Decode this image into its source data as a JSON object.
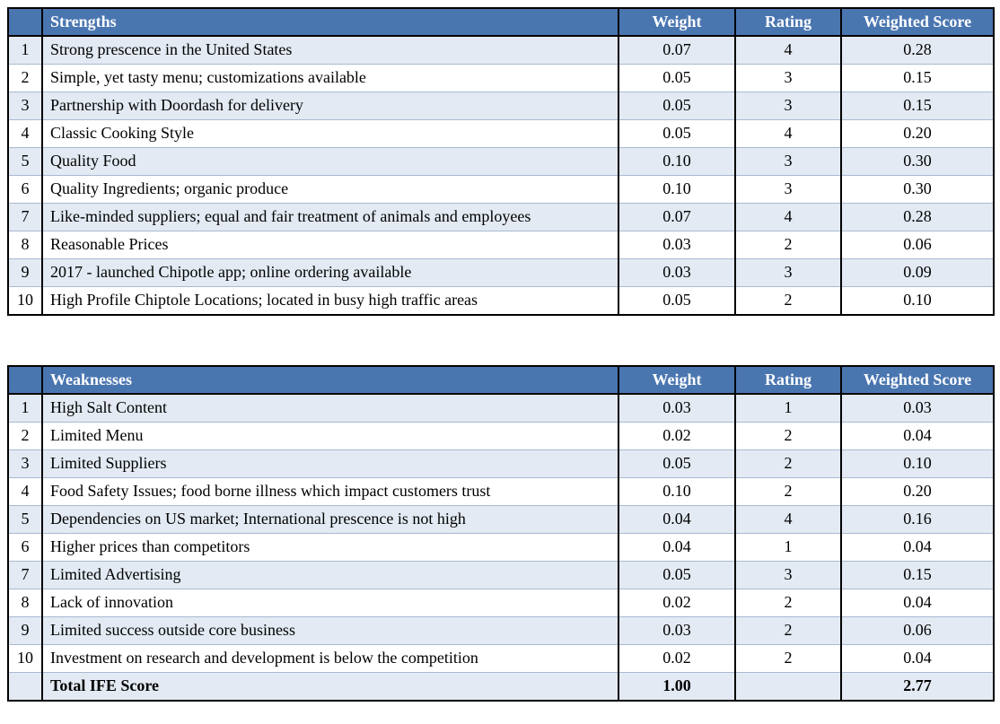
{
  "strengths": {
    "headers": {
      "desc": "Strengths",
      "weight": "Weight",
      "rating": "Rating",
      "score": "Weighted Score"
    },
    "rows": [
      {
        "n": "1",
        "desc": "Strong prescence in the United States",
        "w": "0.07",
        "r": "4",
        "s": "0.28"
      },
      {
        "n": "2",
        "desc": "Simple, yet tasty menu; customizations available",
        "w": "0.05",
        "r": "3",
        "s": "0.15"
      },
      {
        "n": "3",
        "desc": "Partnership with Doordash for delivery",
        "w": "0.05",
        "r": "3",
        "s": "0.15"
      },
      {
        "n": "4",
        "desc": "Classic Cooking Style",
        "w": "0.05",
        "r": "4",
        "s": "0.20"
      },
      {
        "n": "5",
        "desc": "Quality Food",
        "w": "0.10",
        "r": "3",
        "s": "0.30"
      },
      {
        "n": "6",
        "desc": "Quality Ingredients; organic produce",
        "w": "0.10",
        "r": "3",
        "s": "0.30"
      },
      {
        "n": "7",
        "desc": "Like-minded suppliers; equal and fair treatment of animals and employees",
        "w": "0.07",
        "r": "4",
        "s": "0.28"
      },
      {
        "n": "8",
        "desc": "Reasonable Prices",
        "w": "0.03",
        "r": "2",
        "s": "0.06"
      },
      {
        "n": "9",
        "desc": "2017 - launched Chipotle app; online ordering available",
        "w": "0.03",
        "r": "3",
        "s": "0.09"
      },
      {
        "n": "10",
        "desc": "High Profile Chiptole Locations; located in busy high traffic areas",
        "w": "0.05",
        "r": "2",
        "s": "0.10"
      }
    ]
  },
  "weaknesses": {
    "headers": {
      "desc": "Weaknesses",
      "weight": "Weight",
      "rating": "Rating",
      "score": "Weighted Score"
    },
    "rows": [
      {
        "n": "1",
        "desc": "High Salt Content",
        "w": "0.03",
        "r": "1",
        "s": "0.03"
      },
      {
        "n": "2",
        "desc": "Limited Menu",
        "w": "0.02",
        "r": "2",
        "s": "0.04"
      },
      {
        "n": "3",
        "desc": "Limited Suppliers",
        "w": "0.05",
        "r": "2",
        "s": "0.10"
      },
      {
        "n": "4",
        "desc": "Food Safety Issues; food borne illness which impact customers trust",
        "w": "0.10",
        "r": "2",
        "s": "0.20"
      },
      {
        "n": "5",
        "desc": "Dependencies on US market; International prescence is not high",
        "w": "0.04",
        "r": "4",
        "s": "0.16"
      },
      {
        "n": "6",
        "desc": "Higher prices than competitors",
        "w": "0.04",
        "r": "1",
        "s": "0.04"
      },
      {
        "n": "7",
        "desc": "Limited Advertising",
        "w": "0.05",
        "r": "3",
        "s": "0.15"
      },
      {
        "n": "8",
        "desc": "Lack of innovation",
        "w": "0.02",
        "r": "2",
        "s": "0.04"
      },
      {
        "n": "9",
        "desc": "Limited success outside core business",
        "w": "0.03",
        "r": "2",
        "s": "0.06"
      },
      {
        "n": "10",
        "desc": "Investment on research and development is below the competition",
        "w": "0.02",
        "r": "2",
        "s": "0.04"
      }
    ],
    "total": {
      "label": "Total IFE Score",
      "w": "1.00",
      "r": "",
      "s": "2.77"
    }
  }
}
